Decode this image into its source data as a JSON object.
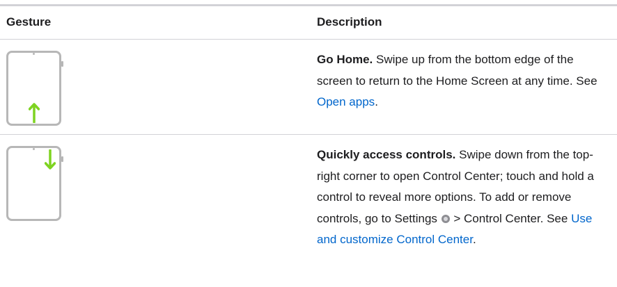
{
  "table": {
    "headers": {
      "gesture": "Gesture",
      "description": "Description"
    },
    "rows": [
      {
        "gesture_icon": "swipe-up-from-bottom-icon",
        "lead": "Go Home.",
        "text": " Swipe up from the bottom edge of the screen to return to the Home Screen at any time. See ",
        "link": "Open apps",
        "end": "."
      },
      {
        "gesture_icon": "swipe-down-from-top-right-icon",
        "lead": "Quickly access controls.",
        "text": " Swipe down from the top-right corner to open Control Center; touch and hold a control to reveal more options. To add or remove controls, go to Settings ",
        "settings_icon": "settings-gear-icon",
        "text2": " > Control Center. See ",
        "link": "Use and customize Control Center",
        "end": "."
      }
    ]
  },
  "colors": {
    "arrow": "#7ed321",
    "link": "#0066cc",
    "rule": "#d2d2d7",
    "device_outline": "#b7b7b7"
  }
}
